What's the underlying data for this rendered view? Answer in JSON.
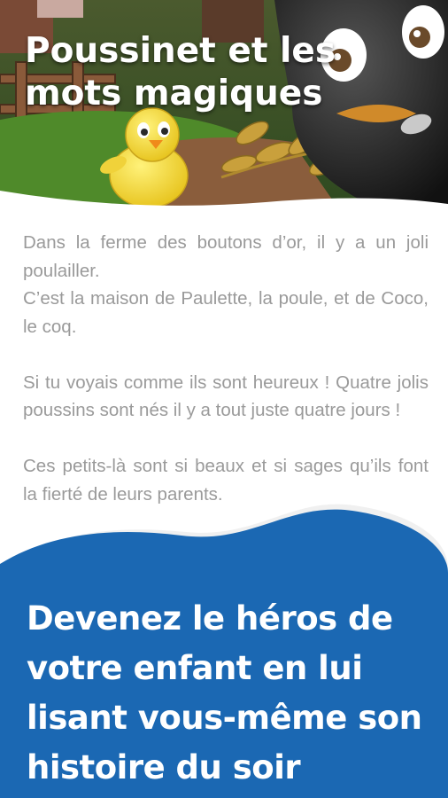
{
  "story": {
    "title": "Poussinet et les mots magiques",
    "paragraphs": [
      "Dans la ferme des boutons d’or, il y a un joli poulailler.\nC’est la maison de Paulette, la poule, et de Coco, le coq.",
      "Si tu voyais comme ils sont heureux ! Quatre jolis poussins sont nés il y a tout juste quatre jours !",
      "Ces petits-là sont si beaux et si sages qu’ils font la fierté de leurs parents."
    ]
  },
  "promo": {
    "text": "Devenez le héros de votre enfant en lui lisant vous-même son histoire du soir",
    "color": "#1b68b3"
  },
  "illustration": {
    "subjects": [
      "chick-character",
      "black-character",
      "wheat-ears",
      "wooden-fence"
    ]
  }
}
